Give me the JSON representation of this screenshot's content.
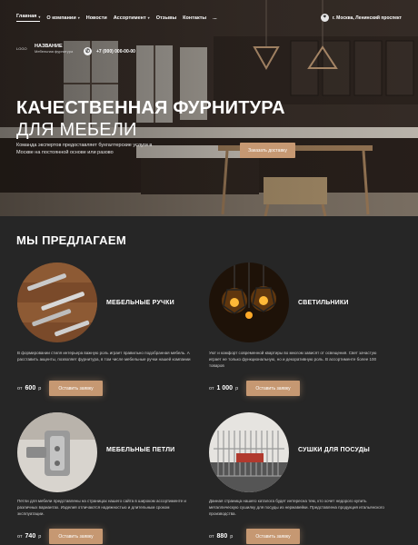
{
  "nav": {
    "items": [
      {
        "label": "Главная",
        "has_dropdown": true,
        "active": true
      },
      {
        "label": "О компании",
        "has_dropdown": true,
        "active": false
      },
      {
        "label": "Новости",
        "has_dropdown": false,
        "active": false
      },
      {
        "label": "Ассортимент",
        "has_dropdown": true,
        "active": false
      },
      {
        "label": "Отзывы",
        "has_dropdown": false,
        "active": false
      },
      {
        "label": "Контакты",
        "has_dropdown": false,
        "active": false
      },
      {
        "label": "...",
        "has_dropdown": false,
        "active": false
      }
    ],
    "address": "г. Москва, Ленинский проспект"
  },
  "brand": {
    "logo_text": "LOGO",
    "name": "НАЗВАНИЕ",
    "subtitle": "Мебельная фурнитура",
    "phone": "+7 (000) 000-00-00"
  },
  "hero": {
    "title_line1": "КАЧЕСТВЕННАЯ ФУРНИТУРА",
    "title_line2": "ДЛЯ МЕБЕЛИ",
    "description": "Команда экспертов предоставляет бухгалтерские услуги в Москве на постоянной основе или разово",
    "button": "Заказать доставку"
  },
  "offers": {
    "title": "МЫ ПРЕДЛАГАЕМ",
    "items": [
      {
        "name": "МЕБЕЛЬНЫЕ РУЧКИ",
        "description": "В формировании стиля интерьера важную роль играет правильно подобранная мебель. А расставить акценты, позволяет фурнитура, в том числе мебельные ручки нашей компании",
        "price_prefix": "от",
        "price": "600",
        "currency": "р",
        "button": "Оставить заявку"
      },
      {
        "name": "СВЕТИЛЬНИКИ",
        "description": "Уют и комфорт современной квартиры во многом зависят от освещения. Свет зачастую играет не только функциональную, но и декоративную роль. В ассортименте более 100 товаров",
        "price_prefix": "от",
        "price": "1 000",
        "currency": "р",
        "button": "Оставить заявку"
      },
      {
        "name": "МЕБЕЛЬНЫЕ ПЕТЛИ",
        "description": "Петли для мебели представлены на страницах нашего сайта в широком ассортименте и различных вариантах. Изделия отличаются надежностью и длительным сроком эксплуатации.",
        "price_prefix": "от",
        "price": "740",
        "currency": "р",
        "button": "Оставить заявку"
      },
      {
        "name": "СУШКИ ДЛЯ ПОСУДЫ",
        "description": "Данная страница нашего каталога будет интересна тем, кто хочет недорого купить металлическую сушилку для посуды из нержавейки. Представлена продукция итальянского производства.",
        "price_prefix": "от",
        "price": "880",
        "currency": "р",
        "button": "Оставить заявку"
      }
    ]
  },
  "colors": {
    "accent": "#c69872",
    "background": "#262626"
  }
}
